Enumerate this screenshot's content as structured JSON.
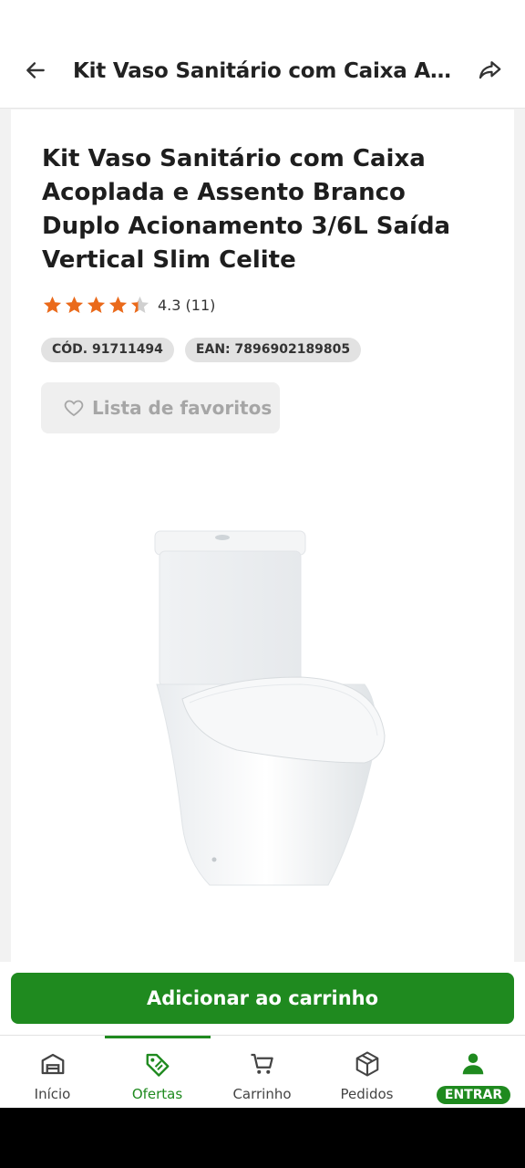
{
  "header": {
    "title": "Kit Vaso Sanitário com Caixa Aco…",
    "back_icon": "arrow-left-icon",
    "share_icon": "share-icon"
  },
  "product": {
    "title": "Kit Vaso Sanitário com Caixa Acoplada e Assento Branco Duplo Acionamento 3/6L Saída Vertical Slim Celite",
    "rating_value": 4.3,
    "rating_text": "4.3 (11)",
    "code": "CÓD. 91711494",
    "ean": "EAN: 7896902189805",
    "favorite_label": "Lista de favoritos"
  },
  "cart": {
    "add_label": "Adicionar ao carrinho"
  },
  "nav": {
    "items": [
      {
        "label": "Início",
        "icon": "store-icon"
      },
      {
        "label": "Ofertas",
        "icon": "tag-icon"
      },
      {
        "label": "Carrinho",
        "icon": "cart-icon"
      },
      {
        "label": "Pedidos",
        "icon": "box-icon"
      },
      {
        "label": "ENTRAR",
        "icon": "user-icon"
      }
    ],
    "active": "Ofertas"
  },
  "colors": {
    "brand_green": "#1f8a1f",
    "star_orange": "#ea6a1b"
  }
}
